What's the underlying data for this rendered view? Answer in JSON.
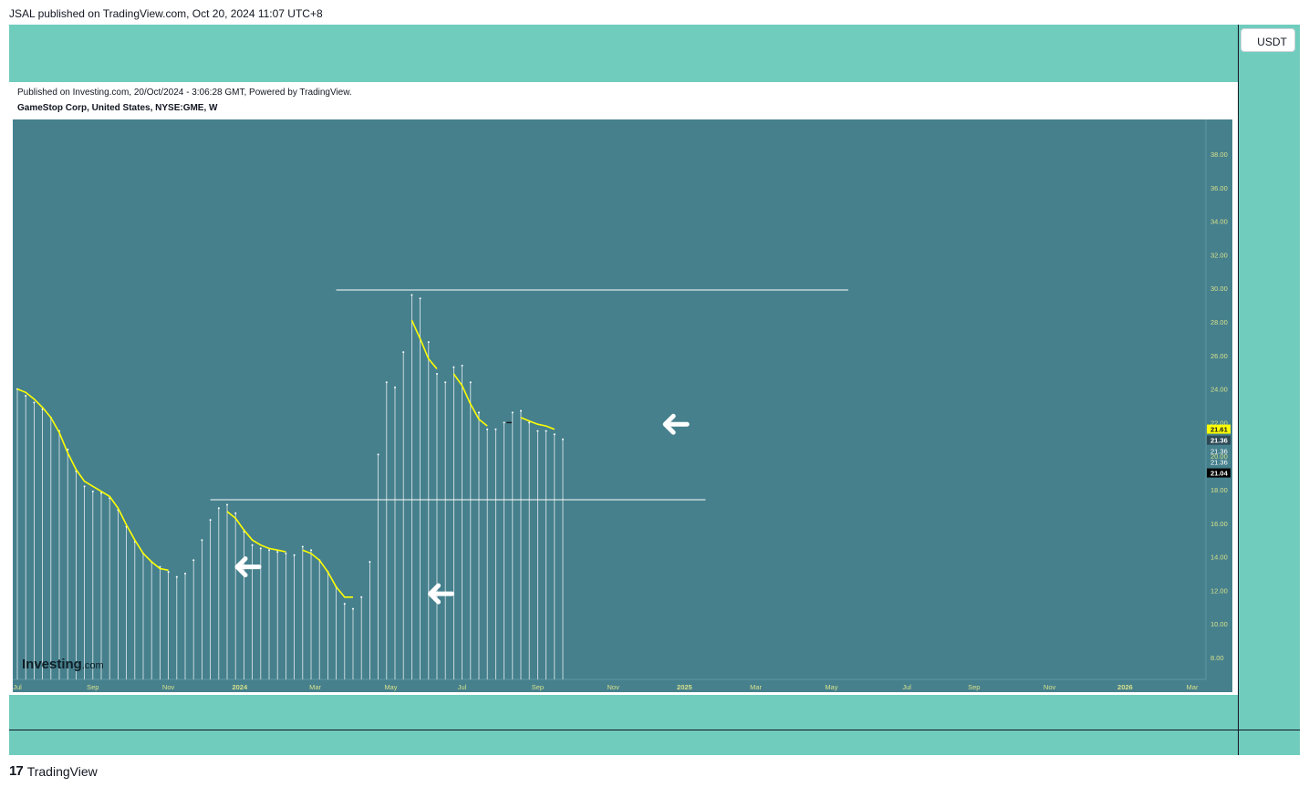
{
  "header": {
    "caption": "JSAL published on TradingView.com, Oct 20, 2024 11:07 UTC+8",
    "currency_button": "USDT"
  },
  "chart_header": {
    "published": "Published on Investing.com, 20/Oct/2024 - 3:06:28 GMT, Powered by TradingView.",
    "symbol": "GameStop Corp, United States, NYSE:GME, W"
  },
  "watermark": {
    "brand": "Investing",
    "suffix": ".com"
  },
  "footer": {
    "brand": "TradingView",
    "mark": "17"
  },
  "colors": {
    "background": "#46808d",
    "frame": "#70ccbd",
    "ma_line": "#ffff00",
    "candle": "#ffffff"
  },
  "chart_data": {
    "type": "line",
    "title": "",
    "ylim": [
      7,
      40.5
    ],
    "y_ticks": [
      "8.00",
      "10.00",
      "12.00",
      "14.00",
      "16.00",
      "18.00",
      "20.00",
      "22.00",
      "24.00",
      "26.00",
      "28.00",
      "30.00",
      "32.00",
      "34.00",
      "36.00",
      "38.00"
    ],
    "x_ticks": [
      {
        "label": "Jul",
        "week": 0
      },
      {
        "label": "Sep",
        "week": 9
      },
      {
        "label": "Nov",
        "week": 18
      },
      {
        "label": "2024",
        "week": 26.5
      },
      {
        "label": "Mar",
        "week": 35.5
      },
      {
        "label": "May",
        "week": 44.5
      },
      {
        "label": "Jul",
        "week": 53
      },
      {
        "label": "Sep",
        "week": 62
      },
      {
        "label": "Nov",
        "week": 71
      },
      {
        "label": "2025",
        "week": 79.5
      },
      {
        "label": "Mar",
        "week": 88
      },
      {
        "label": "May",
        "week": 97
      },
      {
        "label": "Jul",
        "week": 106
      },
      {
        "label": "Sep",
        "week": 114
      },
      {
        "label": "Nov",
        "week": 123
      },
      {
        "label": "2026",
        "week": 132
      },
      {
        "label": "Mar",
        "week": 140
      }
    ],
    "weekly_closes": [
      24.0,
      23.6,
      23.2,
      22.8,
      22.3,
      21.5,
      20.4,
      19.1,
      18.2,
      17.9,
      17.8,
      17.5,
      16.8,
      15.8,
      14.9,
      14.2,
      13.7,
      13.4,
      13.1,
      12.8,
      13.0,
      13.8,
      15.0,
      16.2,
      16.9,
      17.1,
      16.6,
      15.5,
      14.7,
      14.5,
      14.4,
      14.3,
      14.2,
      14.1,
      14.6,
      14.4,
      13.8,
      13.1,
      12.2,
      11.2,
      10.9,
      11.6,
      13.7,
      20.1,
      24.4,
      24.1,
      26.2,
      29.6,
      29.4,
      26.8,
      24.9,
      24.4,
      25.3,
      25.4,
      24.4,
      22.6,
      21.6,
      21.6,
      22.0,
      22.6,
      22.7,
      22.0,
      21.5,
      21.5,
      21.3,
      21.0
    ],
    "ma_segments": [
      {
        "start": 0,
        "values": [
          24.0,
          23.8,
          23.4,
          22.9,
          22.3,
          21.4,
          20.2,
          19.2,
          18.5,
          18.2,
          17.9,
          17.6,
          16.9,
          15.9,
          15.0,
          14.2,
          13.7,
          13.3,
          13.2
        ]
      },
      {
        "start": 25,
        "values": [
          16.7,
          16.3,
          15.6,
          15.0,
          14.7,
          14.5,
          14.4,
          14.3
        ]
      },
      {
        "start": 34,
        "values": [
          14.4,
          14.2,
          13.8,
          13.1,
          12.2,
          11.6,
          11.6
        ]
      },
      {
        "start": 47,
        "values": [
          28.1,
          27.0,
          25.8,
          25.2
        ]
      },
      {
        "start": 52,
        "values": [
          24.9,
          24.2,
          23.1,
          22.2,
          21.8
        ]
      },
      {
        "start": 60,
        "values": [
          22.3,
          22.1,
          21.9,
          21.8,
          21.6
        ]
      }
    ],
    "horizontal_lines": [
      {
        "y": 29.9,
        "from_week": 38,
        "to_week": 99
      },
      {
        "y": 17.4,
        "from_week": 23,
        "to_week": 82
      }
    ],
    "arrows": [
      {
        "week": 27.5,
        "y": 13.4
      },
      {
        "week": 50.5,
        "y": 11.8
      },
      {
        "week": 78.5,
        "y": 21.9
      }
    ],
    "price_labels": [
      {
        "text": "21.61",
        "y": 21.61,
        "style": "yellow"
      },
      {
        "text": "21.36",
        "y": 20.95,
        "style": "dark"
      },
      {
        "text": "21.36",
        "y": 20.3,
        "style": "plain"
      },
      {
        "text": "21.36",
        "y": 19.65,
        "style": "plain"
      },
      {
        "text": "21.04",
        "y": 19.0,
        "style": "black"
      }
    ]
  }
}
